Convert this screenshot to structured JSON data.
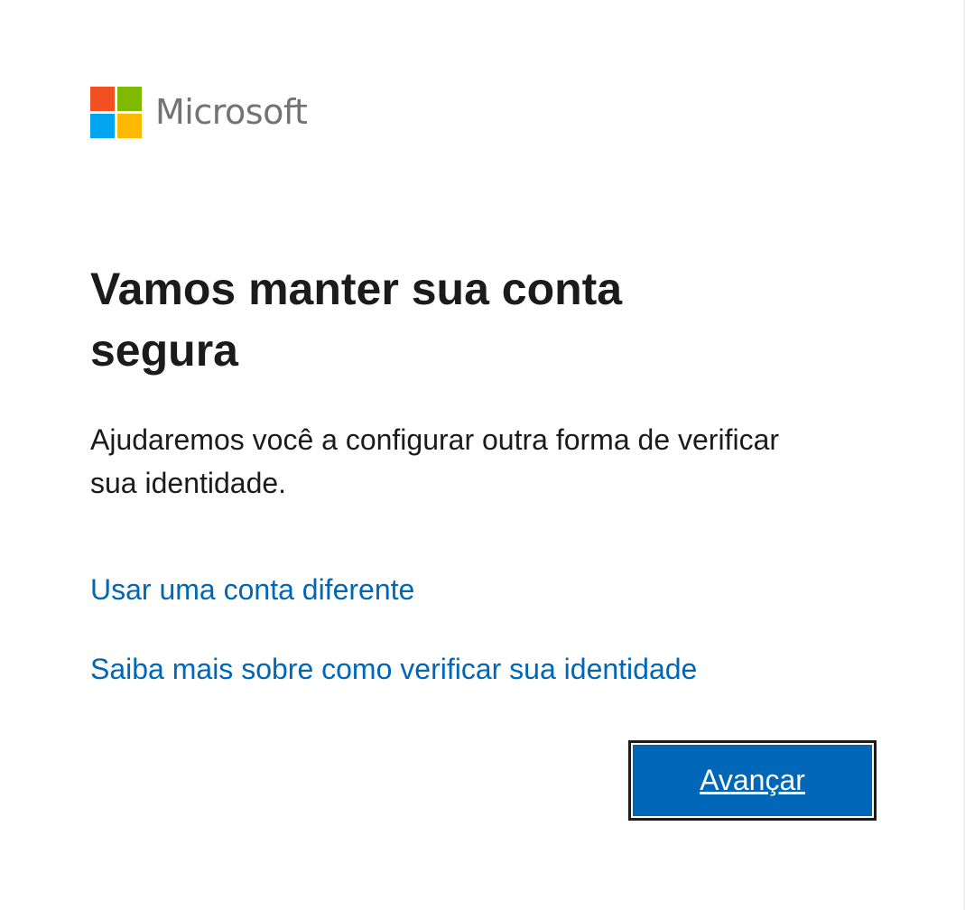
{
  "brand": {
    "name": "Microsoft",
    "logo_icon": "microsoft-logo-icon",
    "logo_colors": [
      "#f25022",
      "#7fba00",
      "#00a4ef",
      "#ffb900"
    ]
  },
  "content": {
    "title": "Vamos manter sua conta segura",
    "description": "Ajudaremos você a configurar outra forma de verificar sua identidade."
  },
  "links": {
    "use_different_account": "Usar uma conta diferente",
    "learn_more": "Saiba mais sobre como verificar sua identidade"
  },
  "actions": {
    "next_label": "Avançar"
  },
  "colors": {
    "accent": "#0067b8",
    "text": "#1b1b1b",
    "brand_text": "#737373"
  }
}
